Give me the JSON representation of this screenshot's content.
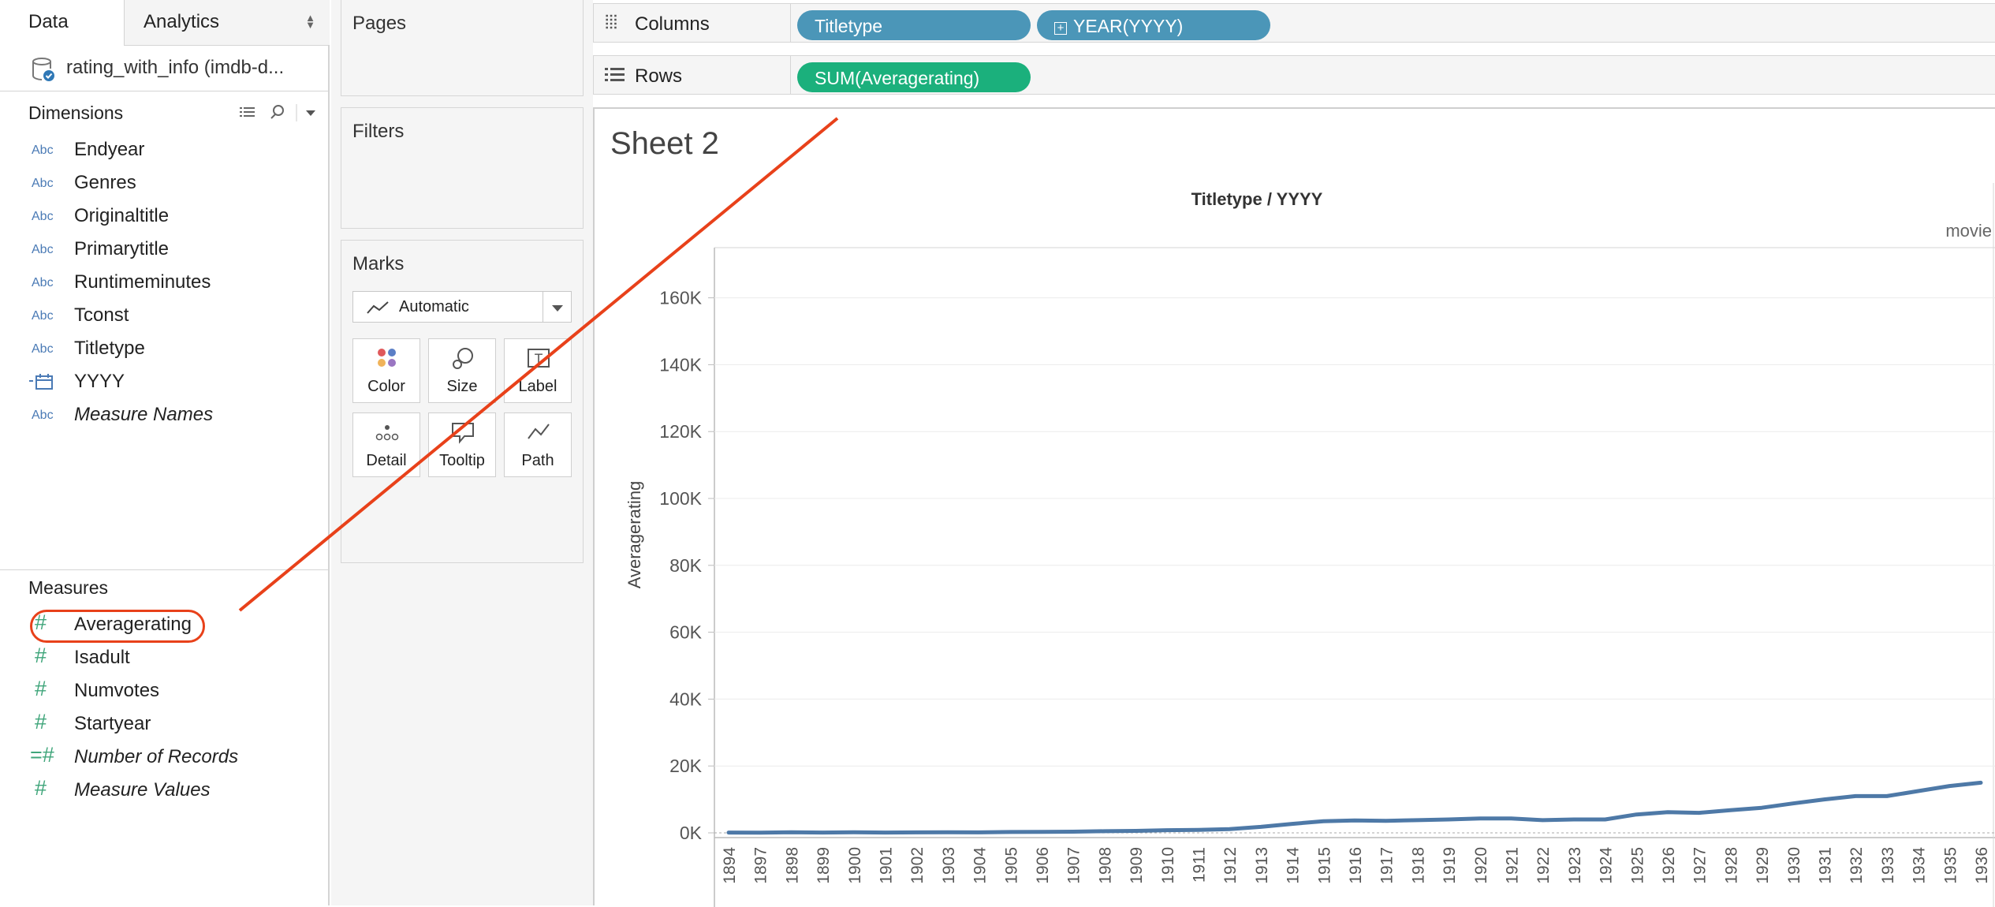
{
  "left_pane": {
    "tabs": [
      {
        "label": "Data"
      },
      {
        "label": "Analytics"
      }
    ],
    "datasource": "rating_with_info (imdb-d...",
    "dimensions_header": "Dimensions",
    "dimensions": [
      {
        "type": "Abc",
        "name": "Endyear"
      },
      {
        "type": "Abc",
        "name": "Genres"
      },
      {
        "type": "Abc",
        "name": "Originaltitle"
      },
      {
        "type": "Abc",
        "name": "Primarytitle"
      },
      {
        "type": "Abc",
        "name": "Runtimeminutes"
      },
      {
        "type": "Abc",
        "name": "Tconst"
      },
      {
        "type": "Abc",
        "name": "Titletype"
      },
      {
        "type": "date",
        "name": "YYYY"
      },
      {
        "type": "Abc",
        "name": "Measure Names"
      }
    ],
    "measures_header": "Measures",
    "measures": [
      {
        "name": "Averagerating",
        "highlighted": true
      },
      {
        "name": "Isadult"
      },
      {
        "name": "Numvotes"
      },
      {
        "name": "Startyear"
      },
      {
        "name": "Number of Records",
        "calculated": true
      },
      {
        "name": "Measure Values"
      }
    ]
  },
  "shelves": {
    "pages": "Pages",
    "filters": "Filters",
    "marks": "Marks",
    "mark_type": "Automatic",
    "mark_buttons": [
      "Color",
      "Size",
      "Label",
      "Detail",
      "Tooltip",
      "Path"
    ],
    "columns_label": "Columns",
    "rows_label": "Rows",
    "column_pills": [
      "Titletype",
      "YEAR(YYYY)"
    ],
    "row_pills": [
      "SUM(Averagerating)"
    ]
  },
  "sheet": {
    "title": "Sheet 2",
    "header": "Titletype / YYYY",
    "pane_label": "movie"
  },
  "colors": {
    "line": "#4e79a7",
    "annotation": "#e8411a",
    "pill_dimension": "#4b96b8",
    "pill_measure": "#1bb07c"
  },
  "chart_data": {
    "type": "line",
    "title": "",
    "xlabel": "",
    "ylabel": "Averagerating",
    "ylim": [
      0,
      175000
    ],
    "ytick_labels": [
      "0K",
      "20K",
      "40K",
      "60K",
      "80K",
      "100K",
      "120K",
      "140K",
      "160K"
    ],
    "yticks": [
      0,
      20000,
      40000,
      60000,
      80000,
      100000,
      120000,
      140000,
      160000
    ],
    "categories": [
      "1894",
      "1897",
      "1898",
      "1899",
      "1900",
      "1901",
      "1902",
      "1903",
      "1904",
      "1905",
      "1906",
      "1907",
      "1908",
      "1909",
      "1910",
      "1911",
      "1912",
      "1913",
      "1914",
      "1915",
      "1916",
      "1917",
      "1918",
      "1919",
      "1920",
      "1921",
      "1922",
      "1923",
      "1924",
      "1925",
      "1926",
      "1927",
      "1928",
      "1929",
      "1930",
      "1931",
      "1932",
      "1933",
      "1934",
      "1935",
      "1936"
    ],
    "series": [
      {
        "values": [
          100,
          50,
          200,
          100,
          200,
          100,
          150,
          200,
          150,
          250,
          300,
          350,
          500,
          600,
          800,
          900,
          1100,
          1800,
          2700,
          3500,
          3700,
          3600,
          3800,
          4000,
          4300,
          4300,
          3800,
          4000,
          4000,
          5500,
          6200,
          6000,
          6800,
          7500,
          8800,
          10000,
          11000,
          11000,
          12500,
          14000,
          15000
        ]
      }
    ]
  }
}
